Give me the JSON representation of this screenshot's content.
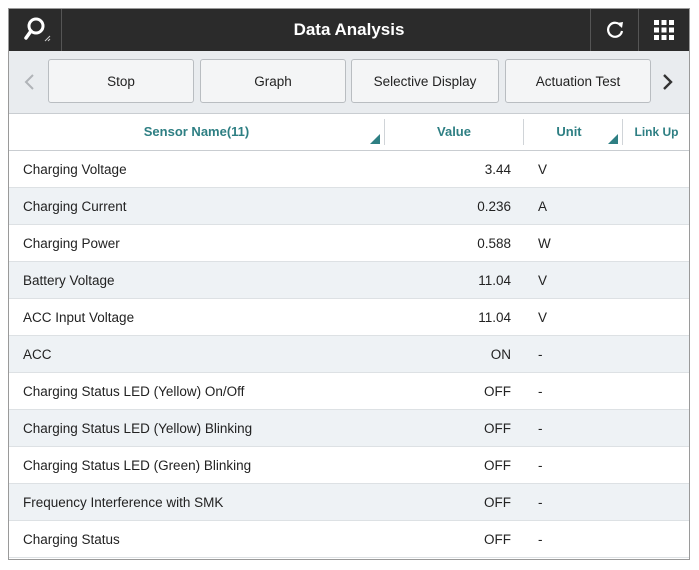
{
  "titlebar": {
    "title": "Data Analysis",
    "search_icon": "search-icon",
    "refresh_icon": "refresh-icon",
    "grid_icon": "grid-menu-icon"
  },
  "toolbar": {
    "buttons": [
      "Stop",
      "Graph",
      "Selective Display",
      "Actuation Test"
    ],
    "prev_icon": "chevron-left-icon",
    "next_icon": "chevron-right-icon"
  },
  "table": {
    "headers": {
      "name": "Sensor Name(11)",
      "value": "Value",
      "unit": "Unit",
      "link": "Link Up"
    },
    "rows": [
      {
        "name": "Charging Voltage",
        "value": "3.44",
        "unit": "V"
      },
      {
        "name": "Charging Current",
        "value": "0.236",
        "unit": "A"
      },
      {
        "name": "Charging Power",
        "value": "0.588",
        "unit": "W"
      },
      {
        "name": "Battery Voltage",
        "value": "11.04",
        "unit": "V"
      },
      {
        "name": "ACC Input Voltage",
        "value": "11.04",
        "unit": "V"
      },
      {
        "name": "ACC",
        "value": "ON",
        "unit": "-"
      },
      {
        "name": "Charging Status LED (Yellow) On/Off",
        "value": "OFF",
        "unit": "-"
      },
      {
        "name": "Charging Status LED (Yellow) Blinking",
        "value": "OFF",
        "unit": "-"
      },
      {
        "name": "Charging Status LED (Green) Blinking",
        "value": "OFF",
        "unit": "-"
      },
      {
        "name": "Frequency Interference with SMK",
        "value": "OFF",
        "unit": "-"
      },
      {
        "name": "Charging Status",
        "value": "OFF",
        "unit": "-"
      }
    ]
  },
  "colors": {
    "titlebar_bg": "#2b2b2b",
    "header_text": "#2e7f83",
    "row_alt": "#eef2f5"
  }
}
